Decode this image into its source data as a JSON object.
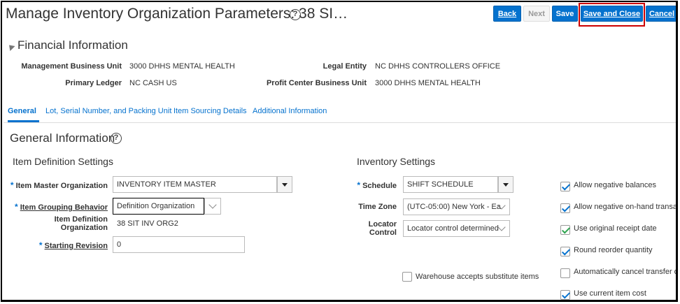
{
  "header": {
    "title": "Manage Inventory Organization Parameters: 38 SI…",
    "help_glyph": "?",
    "buttons": {
      "back": "Back",
      "next": "Next",
      "save": "Save",
      "save_and_close": "Save and Close",
      "cancel": "Cancel"
    }
  },
  "financial": {
    "title": "Financial Information",
    "fields": [
      {
        "label": "Management Business Unit",
        "value": "3000 DHHS MENTAL HEALTH"
      },
      {
        "label": "Primary Ledger",
        "value": "NC CASH US"
      },
      {
        "label": "Legal Entity",
        "value": "NC DHHS CONTROLLERS OFFICE"
      },
      {
        "label": "Profit Center Business Unit",
        "value": "3000 DHHS MENTAL HEALTH"
      }
    ]
  },
  "tabs": [
    "General",
    "Lot, Serial Number, and Packing Unit",
    "Item Sourcing Details",
    "Additional Information"
  ],
  "general": {
    "title": "General Information",
    "item_definition": {
      "title": "Item Definition Settings",
      "item_master_org": {
        "label": "Item Master Organization",
        "value": "INVENTORY ITEM MASTER"
      },
      "item_grouping": {
        "label": "Item Grouping Behavior",
        "value": "Definition Organization"
      },
      "item_def_org": {
        "label_line1": "Item Definition",
        "label_line2": "Organization",
        "value": "38 SIT INV ORG2"
      },
      "starting_revision": {
        "label": "Starting Revision",
        "value": "0"
      }
    },
    "inventory": {
      "title": "Inventory Settings",
      "schedule": {
        "label": "Schedule",
        "value": "SHIFT SCHEDULE"
      },
      "time_zone": {
        "label": "Time Zone",
        "value": "(UTC-05:00) New York - Ea"
      },
      "locator_control": {
        "label_line1": "Locator",
        "label_line2": "Control",
        "value": "Locator control determined"
      },
      "warehouse_sub": {
        "label": "Warehouse accepts substitute items",
        "checked": false
      }
    },
    "checkboxes": [
      {
        "label": "Allow negative balances",
        "checked": true
      },
      {
        "label": "Allow negative on-hand transactio",
        "checked": true
      },
      {
        "label": "Use original receipt date",
        "checked": true
      },
      {
        "label": "Round reorder quantity",
        "checked": true
      },
      {
        "label": "Automatically cancel transfer orde",
        "checked": false
      },
      {
        "label": "Use current item cost",
        "checked": true
      }
    ]
  },
  "required_marker": "*"
}
